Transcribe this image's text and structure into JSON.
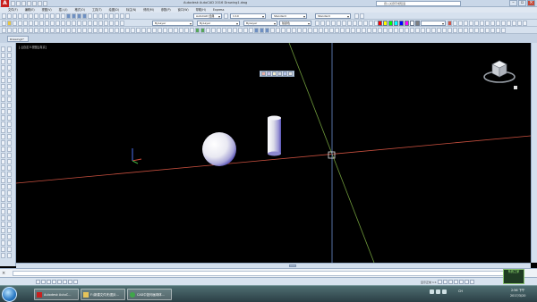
{
  "app": {
    "logo": "A",
    "title": "Autodesk AutoCAD 2016    Drawing1.dwg",
    "help_search_placeholder": "键入关键字或短语"
  },
  "menu": [
    "文件(F)",
    "编辑(E)",
    "视图(V)",
    "插入(I)",
    "格式(O)",
    "工具(T)",
    "绘图(D)",
    "标注(N)",
    "修改(M)",
    "参数(P)",
    "窗口(W)",
    "帮助(H)",
    "Express"
  ],
  "toolbar": {
    "workspace": "AutoCAD 经典",
    "scale": "1:10",
    "text_style": "Standard",
    "dim_style": "Standard",
    "layer": "ByLayer",
    "linetype": "ByLayer",
    "lineweight": "ByLayer",
    "plot_style": "随颜色"
  },
  "file_tab": "Drawing1*",
  "viewport": {
    "label": "[-][自定义视图][真实]",
    "colors": {
      "background": "#000000",
      "red_axis": "#c9503f",
      "green_axis": "#6f9a3b",
      "blue_axis": "#6c8fd0"
    }
  },
  "status": {
    "model_label": "模型",
    "scale_label": "1:1 / 100%",
    "right_text": "显示正常 1:1"
  },
  "taskbar": {
    "items": [
      {
        "label": "Autodesk AutoC...",
        "icon": "autocad-icon"
      },
      {
        "label": "F:\\新建文件夹\\图片...",
        "icon": "folder-icon"
      },
      {
        "label": "CAD中如何画球体...",
        "icon": "browser-icon"
      }
    ],
    "lang": "CH",
    "time": "2:56 下午",
    "date": "2017/3/20"
  },
  "badge": "系统之家"
}
